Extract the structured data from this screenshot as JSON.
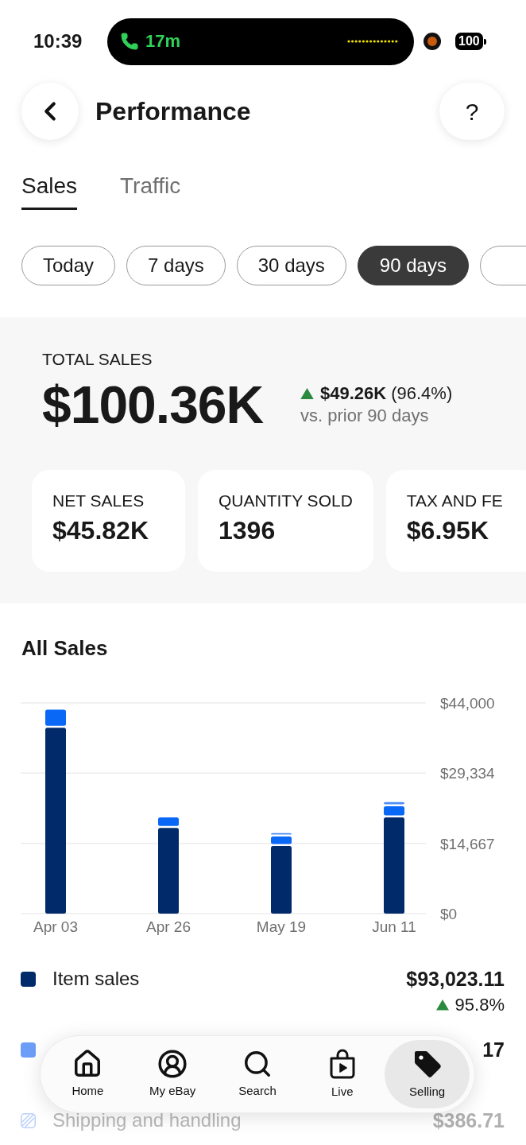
{
  "status_bar": {
    "time": "10:39",
    "call_duration": "17m",
    "battery": "100"
  },
  "header": {
    "title": "Performance",
    "help_label": "?"
  },
  "tabs": [
    {
      "label": "Sales",
      "selected": true
    },
    {
      "label": "Traffic",
      "selected": false
    }
  ],
  "period_chips": [
    {
      "label": "Today",
      "selected": false
    },
    {
      "label": "7 days",
      "selected": false
    },
    {
      "label": "30 days",
      "selected": false
    },
    {
      "label": "90 days",
      "selected": true
    }
  ],
  "summary": {
    "label": "TOTAL SALES",
    "value": "$100.36K",
    "increase": true,
    "change": "$49.26K",
    "change_percent": "(96.4%)",
    "comparison": "vs. prior 90 days"
  },
  "metric_cards": [
    {
      "label": "NET SALES",
      "value": "$45.82K"
    },
    {
      "label": "QUANTITY SOLD",
      "value": "1396"
    },
    {
      "label": "TAX AND FE",
      "value": "$6.95K"
    }
  ],
  "all_sales": {
    "title": "All Sales",
    "chart_data": {
      "type": "bar",
      "stacked": true,
      "categories": [
        "Apr 03",
        "Apr 26",
        "May 19",
        "Jun 11"
      ],
      "series": [
        {
          "color": "#002a69",
          "values": [
            38800,
            17900,
            14100,
            20100
          ]
        },
        {
          "color": "#0968f6",
          "values": [
            3800,
            2200,
            2000,
            2300
          ]
        },
        {
          "color": "#4c8df7",
          "values": [
            0,
            0,
            700,
            900
          ]
        }
      ],
      "ylim": [
        0,
        44000
      ],
      "yticks": [
        {
          "value": 0,
          "label": "$0"
        },
        {
          "value": 14667,
          "label": "$14,667"
        },
        {
          "value": 29334,
          "label": "$29,334"
        },
        {
          "value": 44000,
          "label": "$44,000"
        }
      ]
    },
    "legend": [
      {
        "kind": "solid",
        "name": "Item sales",
        "color": "#002a69",
        "value": "$93,023.11",
        "increase": true,
        "change": "95.8%"
      },
      {
        "kind": "solid",
        "color": "#6d9ef7",
        "value": "17"
      },
      {
        "kind": "striped",
        "name": "Shipping and handling",
        "color": "#b9cffa",
        "value": "$386.71"
      }
    ]
  },
  "bottom_nav": [
    {
      "label": "Home",
      "selected": false
    },
    {
      "label": "My eBay",
      "selected": false
    },
    {
      "label": "Search",
      "selected": false
    },
    {
      "label": "Live",
      "selected": false
    },
    {
      "label": "Selling",
      "selected": true
    }
  ]
}
